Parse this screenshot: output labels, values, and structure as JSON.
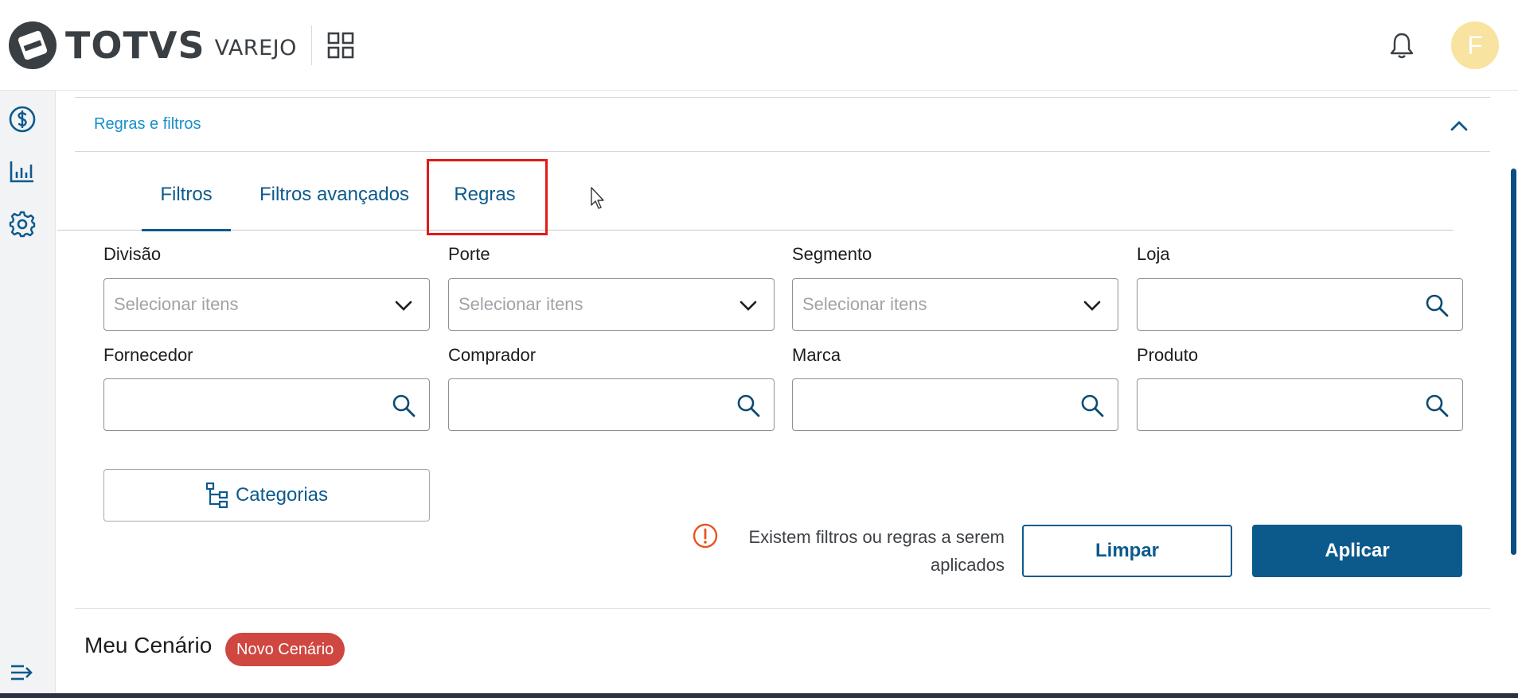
{
  "header": {
    "logo_text": "TOTVS",
    "logo_sub": "VAREJO",
    "avatar_initial": "F"
  },
  "accordion": {
    "title": "Regras e filtros"
  },
  "tabs": [
    {
      "label": "Filtros",
      "active": true
    },
    {
      "label": "Filtros avançados",
      "active": false
    },
    {
      "label": "Regras",
      "active": false
    }
  ],
  "filters": {
    "divisao": {
      "label": "Divisão",
      "placeholder": "Selecionar itens"
    },
    "porte": {
      "label": "Porte",
      "placeholder": "Selecionar itens"
    },
    "segmento": {
      "label": "Segmento",
      "placeholder": "Selecionar itens"
    },
    "loja": {
      "label": "Loja"
    },
    "fornecedor": {
      "label": "Fornecedor"
    },
    "comprador": {
      "label": "Comprador"
    },
    "marca": {
      "label": "Marca"
    },
    "produto": {
      "label": "Produto"
    }
  },
  "categorias_label": "Categorias",
  "warning": {
    "text": "Existem filtros ou regras a serem aplicados"
  },
  "actions": {
    "limpar": "Limpar",
    "aplicar": "Aplicar"
  },
  "scenario": {
    "title": "Meu Cenário",
    "badge": "Novo Cenário"
  },
  "colors": {
    "primary": "#0c5a8c",
    "accent_link": "#1690c7",
    "highlight": "#e01b1b",
    "warning": "#e8541f",
    "badge": "#d04640",
    "avatar": "#f8e3a0"
  }
}
